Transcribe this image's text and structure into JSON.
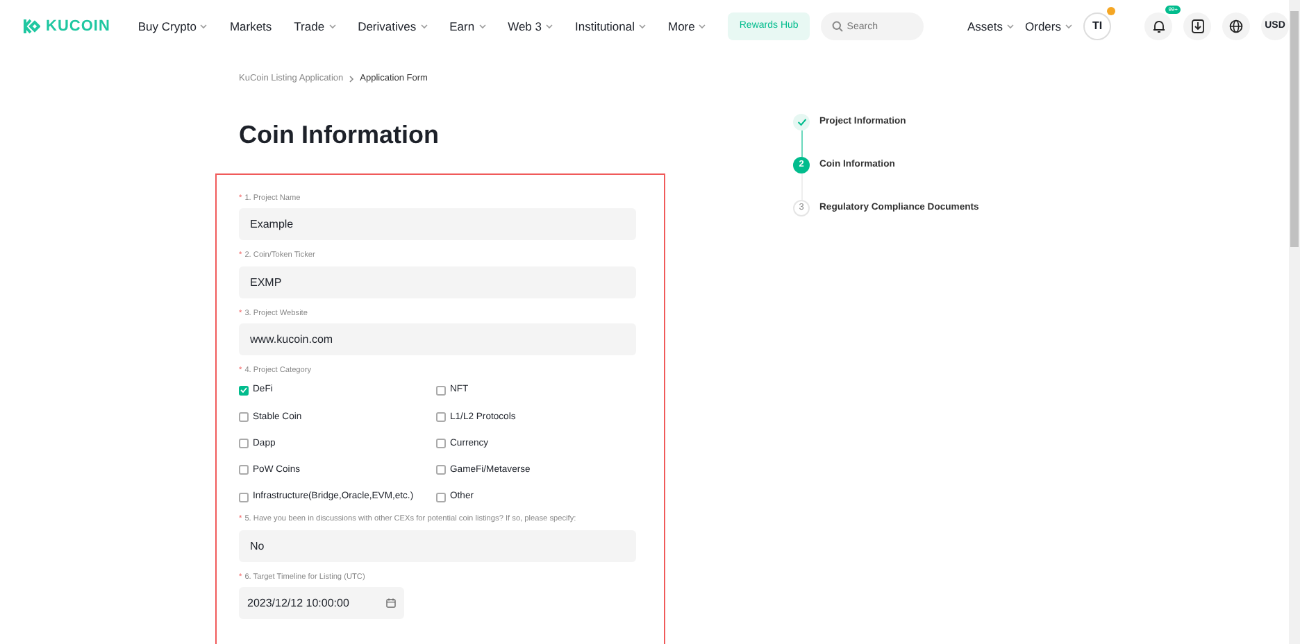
{
  "header": {
    "logo": "KUCOIN",
    "nav": [
      {
        "label": "Buy Crypto",
        "has_menu": true
      },
      {
        "label": "Markets",
        "has_menu": false
      },
      {
        "label": "Trade",
        "has_menu": true
      },
      {
        "label": "Derivatives",
        "has_menu": true
      },
      {
        "label": "Earn",
        "has_menu": true
      },
      {
        "label": "Web 3",
        "has_menu": true
      },
      {
        "label": "Institutional",
        "has_menu": true
      },
      {
        "label": "More",
        "has_menu": true
      }
    ],
    "rewards": "Rewards Hub",
    "search": {
      "placeholder": "Search"
    },
    "right_nav": [
      {
        "label": "Assets",
        "has_menu": true
      },
      {
        "label": "Orders",
        "has_menu": true
      }
    ],
    "avatar": "TI",
    "notification_badge": "99+",
    "currency": "USD"
  },
  "breadcrumb": [
    {
      "label": "KuCoin Listing Application",
      "selected": false
    },
    {
      "label": "Application Form",
      "selected": true
    }
  ],
  "title": "Coin Information",
  "form": {
    "required_mark": "*",
    "fields": [
      {
        "kind": "text",
        "label": "1. Project Name",
        "value": "Example"
      },
      {
        "kind": "text",
        "label": "2. Coin/Token Ticker",
        "value": "EXMP"
      },
      {
        "kind": "text",
        "label": "3. Project Website",
        "value": "www.kucoin.com"
      },
      {
        "kind": "checkboxes",
        "label": "4. Project Category",
        "options": [
          {
            "label": "DeFi",
            "checked": true
          },
          {
            "label": "NFT",
            "checked": false
          },
          {
            "label": "Stable Coin",
            "checked": false
          },
          {
            "label": "L1/L2 Protocols",
            "checked": false
          },
          {
            "label": "Dapp",
            "checked": false
          },
          {
            "label": "Currency",
            "checked": false
          },
          {
            "label": "PoW Coins",
            "checked": false
          },
          {
            "label": "GameFi/Metaverse",
            "checked": false
          },
          {
            "label": "Infrastructure(Bridge,Oracle,EVM,etc.)",
            "checked": false
          },
          {
            "label": "Other",
            "checked": false
          }
        ]
      },
      {
        "kind": "text",
        "label": "5. Have you been in discussions with other CEXs for potential coin listings? If so, please specify:",
        "value": "No"
      },
      {
        "kind": "date",
        "label": "6. Target Timeline for Listing (UTC)",
        "value": "2023/12/12 10:00:00"
      }
    ]
  },
  "steps": [
    {
      "label": "Project Information",
      "done": true,
      "selected": false
    },
    {
      "number": "2",
      "label": "Coin Information",
      "done": false,
      "selected": true
    },
    {
      "number": "3",
      "label": "Regulatory Compliance Documents",
      "done": false,
      "selected": false
    }
  ]
}
